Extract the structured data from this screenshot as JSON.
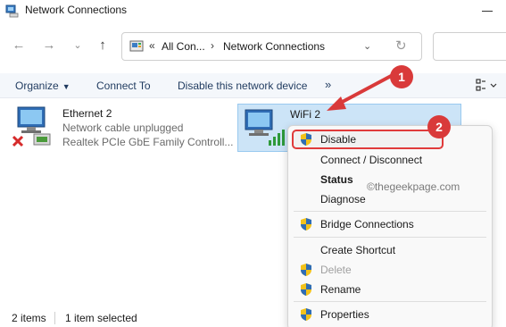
{
  "window": {
    "title": "Network Connections"
  },
  "address": {
    "segment_parent": "All Con...",
    "segment_current": "Network Connections"
  },
  "commands": {
    "organize": "Organize",
    "connect_to": "Connect To",
    "disable_device": "Disable this network device",
    "more": "»"
  },
  "items": {
    "ethernet": {
      "name": "Ethernet 2",
      "status": "Network cable unplugged",
      "device": "Realtek PCIe GbE Family Controll..."
    },
    "wifi": {
      "name": "WiFi 2"
    }
  },
  "context_menu": {
    "items": [
      {
        "label": "Disable",
        "shield": true
      },
      {
        "label": "Connect / Disconnect"
      },
      {
        "label": "Status"
      },
      {
        "label": "Diagnose"
      },
      {
        "label": "Bridge Connections",
        "shield": true
      },
      {
        "label": "Create Shortcut"
      },
      {
        "label": "Delete",
        "shield": true
      },
      {
        "label": "Rename",
        "shield": true
      },
      {
        "label": "Properties",
        "shield": true
      }
    ]
  },
  "annotations": {
    "step1": "1",
    "step2": "2",
    "watermark": "©thegeekpage.com"
  },
  "statusbar": {
    "count": "2 items",
    "selected": "1 item selected"
  },
  "colors": {
    "highlight": "#cce4f7",
    "annotation_red": "#d93a3a",
    "command_text": "#1f3a5f"
  },
  "icons": {
    "title": "network-connections-icon",
    "ethernet": "ethernet-adapter-icon",
    "wifi": "wifi-adapter-icon",
    "shield": "uac-shield-icon"
  }
}
